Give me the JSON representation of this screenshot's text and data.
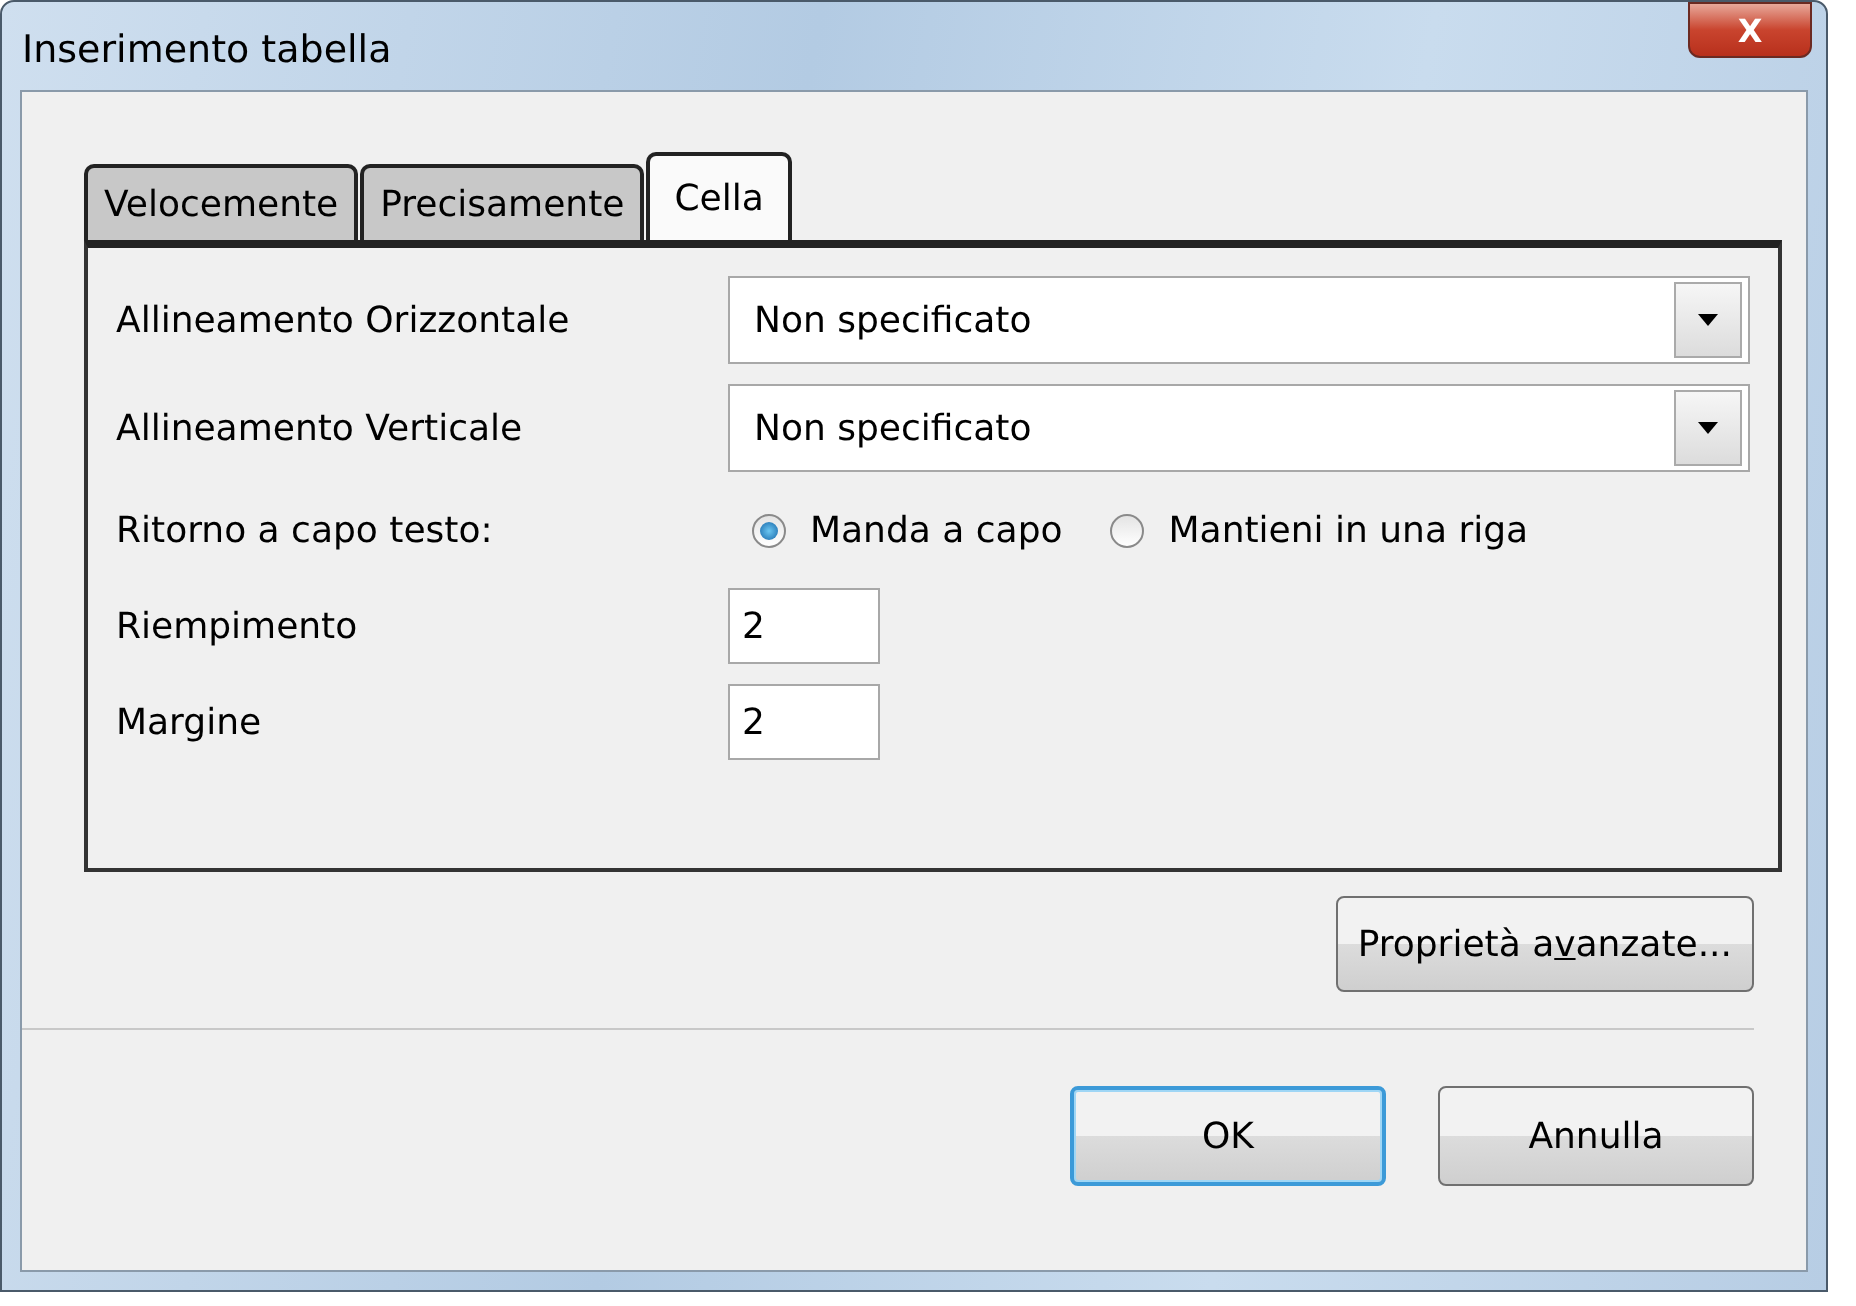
{
  "window": {
    "title": "Inserimento tabella",
    "close_label": "X"
  },
  "tabs": [
    {
      "label": "Velocemente",
      "selected": false
    },
    {
      "label": "Precisamente",
      "selected": false
    },
    {
      "label": "Cella",
      "selected": true
    }
  ],
  "rows": [
    {
      "kind": "dropdown",
      "label": "Allineamento Orizzontale",
      "value": "Non specificato"
    },
    {
      "kind": "dropdown",
      "label": "Allineamento Verticale",
      "value": "Non specificato"
    },
    {
      "kind": "radio",
      "label": "Ritorno a capo testo:",
      "options": [
        {
          "label": "Manda a capo",
          "selected": true
        },
        {
          "label": "Mantieni in una riga",
          "selected": false
        }
      ]
    },
    {
      "kind": "number",
      "label": "Riempimento",
      "value": "2"
    },
    {
      "kind": "number",
      "label": "Margine",
      "value": "2"
    }
  ],
  "advanced_button": {
    "label_before": "Proprietà a",
    "access_key": "v",
    "label_after": "anzate..."
  },
  "buttons": [
    {
      "label": "OK",
      "default": true
    },
    {
      "label": "Annulla",
      "default": false
    }
  ]
}
